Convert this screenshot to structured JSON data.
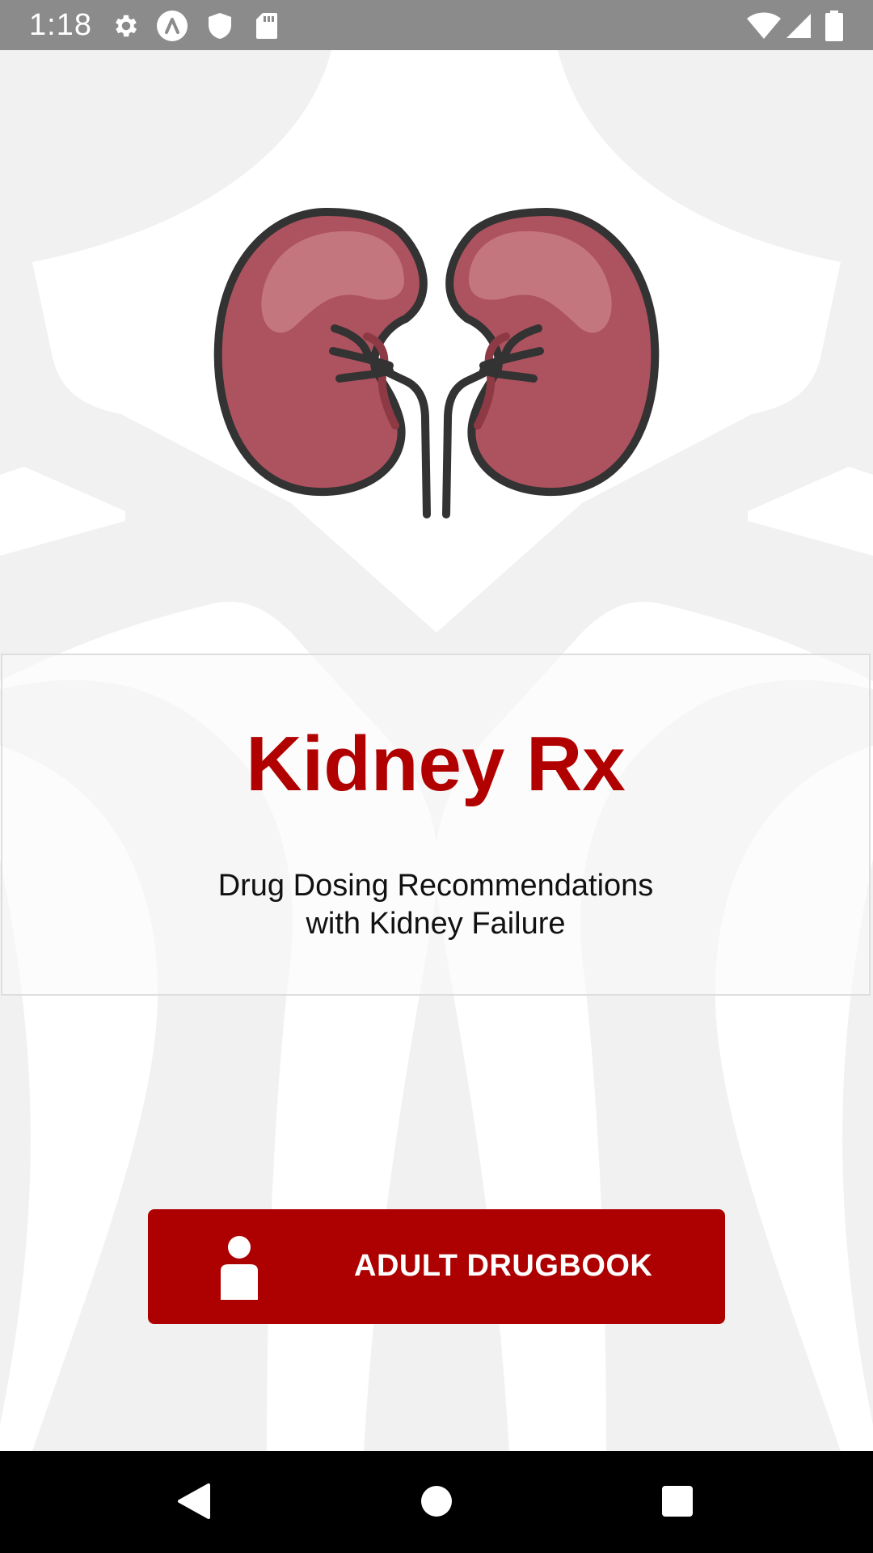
{
  "status_bar": {
    "time": "1:18",
    "left_icons": [
      "gear-icon",
      "lambda-app-icon",
      "shield-icon",
      "sd-card-icon"
    ],
    "right_icons": [
      "wifi-icon",
      "cellular-signal-icon",
      "battery-icon"
    ]
  },
  "hero": {
    "icon": "kidney-illustration"
  },
  "title_card": {
    "title": "Kidney Rx",
    "subtitle_line1": "Drug Dosing Recommendations",
    "subtitle_line2": "with Kidney Failure"
  },
  "main_button": {
    "label": "ADULT DRUGBOOK",
    "icon": "person-icon"
  },
  "nav_bar": {
    "icons": [
      "back-icon",
      "home-icon",
      "recents-icon"
    ]
  },
  "colors": {
    "brand_red": "#ad0000",
    "title_red": "#b10000",
    "kidney_fill": "#ad535f",
    "kidney_highlight": "#c4767f",
    "outline": "#333333",
    "status_bar": "#8b8b8b",
    "background_shape": "#f1f1f1"
  }
}
